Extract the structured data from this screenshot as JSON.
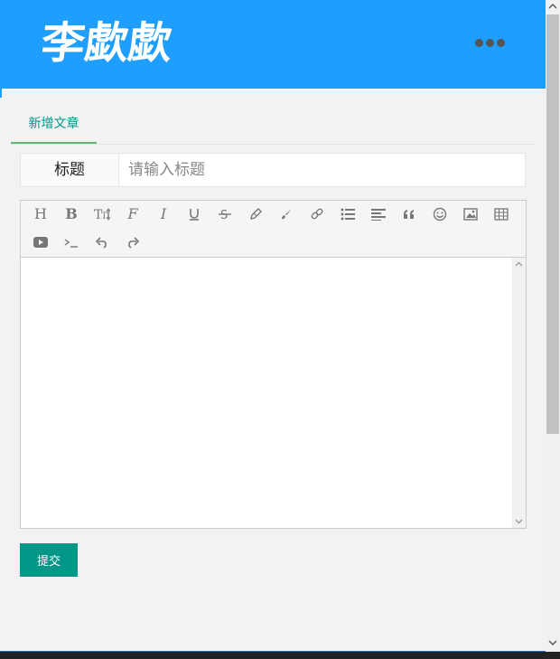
{
  "header": {
    "logo_text": "李歔歔",
    "more_icon": "more-horizontal-icon",
    "background_color": "#1e9fff"
  },
  "tabs": [
    {
      "label": "新增文章",
      "active": true
    }
  ],
  "form": {
    "title_label": "标题",
    "title_placeholder": "请输入标题",
    "title_value": ""
  },
  "editor": {
    "toolbar_icons": [
      "heading-icon",
      "bold-icon",
      "font-size-icon",
      "font-family-icon",
      "italic-icon",
      "underline-icon",
      "strikethrough-icon",
      "pencil-icon",
      "paintbrush-icon",
      "link-icon",
      "list-icon",
      "align-left-icon",
      "quote-icon",
      "emoji-icon",
      "image-icon",
      "table-icon",
      "video-icon",
      "code-icon",
      "undo-icon",
      "redo-icon"
    ],
    "content": ""
  },
  "submit_label": "提交",
  "colors": {
    "accent": "#009688",
    "tab_underline": "#5fb878",
    "header": "#1e9fff"
  }
}
